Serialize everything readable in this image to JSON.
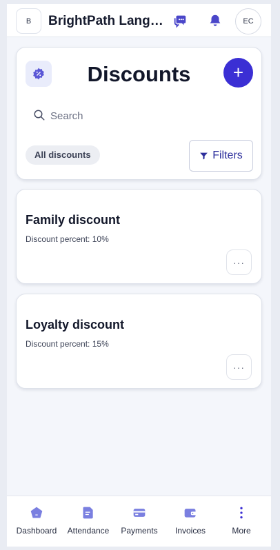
{
  "topbar": {
    "org_initial": "B",
    "org_name": "BrightPath Language Academy",
    "user_initials": "EC",
    "icons": [
      "chat-icon",
      "bell-icon"
    ]
  },
  "header": {
    "title": "Discounts",
    "add_label": "+",
    "search_placeholder": "Search",
    "chip_label": "All discounts",
    "filters_label": "Filters"
  },
  "discounts": [
    {
      "name": "Family discount",
      "detail": "Discount percent: 10%",
      "more_label": "···"
    },
    {
      "name": "Loyalty discount",
      "detail": "Discount percent: 15%",
      "more_label": "···"
    }
  ],
  "bottom_nav": [
    {
      "label": "Dashboard",
      "icon": "pentagon-home-icon"
    },
    {
      "label": "Attendance",
      "icon": "document-icon"
    },
    {
      "label": "Payments",
      "icon": "card-icon"
    },
    {
      "label": "Invoices",
      "icon": "wallet-icon"
    },
    {
      "label": "More",
      "icon": "more-vertical-icon"
    }
  ],
  "colors": {
    "accent": "#3b2fd4",
    "icon_indigo": "#4a46c9",
    "nav_icon": "#7a7fe0",
    "background": "#f4f6fb"
  }
}
